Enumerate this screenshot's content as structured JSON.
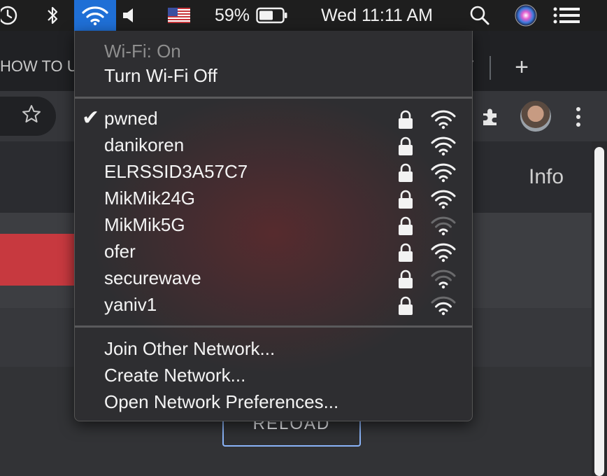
{
  "menubar": {
    "battery_percent": "59%",
    "clock": "Wed 11:11 AM"
  },
  "browser": {
    "tab_title": "HOW TO U",
    "tab_fragment": "Ƭ",
    "new_tab": "+",
    "info_label": "Info",
    "reload_label": "RELOAD"
  },
  "wifi_menu": {
    "status": "Wi-Fi: On",
    "toggle_label": "Turn Wi-Fi Off",
    "networks": [
      {
        "name": "pwned",
        "connected": true,
        "locked": true,
        "signal": 3
      },
      {
        "name": "danikoren",
        "connected": false,
        "locked": true,
        "signal": 3
      },
      {
        "name": "ELRSSID3A57C7",
        "connected": false,
        "locked": true,
        "signal": 3
      },
      {
        "name": "MikMik24G",
        "connected": false,
        "locked": true,
        "signal": 3
      },
      {
        "name": "MikMik5G",
        "connected": false,
        "locked": true,
        "signal": 1
      },
      {
        "name": "ofer",
        "connected": false,
        "locked": true,
        "signal": 3
      },
      {
        "name": "securewave",
        "connected": false,
        "locked": true,
        "signal": 1
      },
      {
        "name": "yaniv1",
        "connected": false,
        "locked": true,
        "signal": 2
      }
    ],
    "join_other": "Join Other Network...",
    "create_network": "Create Network...",
    "open_preferences": "Open Network Preferences..."
  },
  "colors": {
    "wifi_active": "#1f6fd6",
    "menu_bg": "#2e2e31",
    "reload_border": "#8ab4f8",
    "red_bar": "#c7393f"
  },
  "icons": [
    "time-machine-icon",
    "bluetooth-icon",
    "wifi-icon",
    "volume-icon",
    "us-flag-icon",
    "battery-icon",
    "spotlight-search-icon",
    "siri-icon",
    "notification-center-icon",
    "star-icon",
    "extensions-icon",
    "avatar",
    "more-menu-icon",
    "lock-icon",
    "wifi-signal-icon",
    "checkmark-icon"
  ]
}
